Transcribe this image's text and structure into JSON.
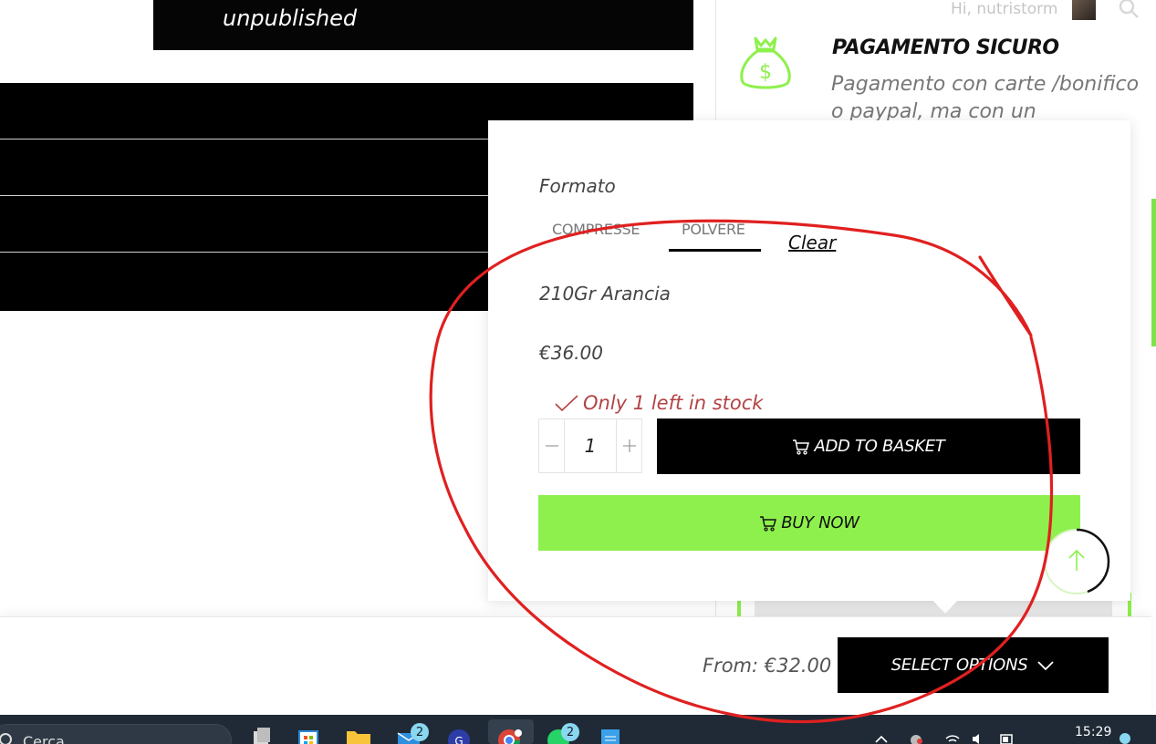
{
  "header": {
    "greeting": "Hi, nutristorm"
  },
  "left": {
    "unpublished_label": "unpublished"
  },
  "sidebar": {
    "title": "PAGAMENTO SICURO",
    "description": "Pagamento con carte /bonifico o paypal, ma con un"
  },
  "popup": {
    "attribute_label": "Formato",
    "options": [
      "COMPRESSE",
      "POLVERE"
    ],
    "selected_option": "POLVERE",
    "clear_label": "Clear",
    "variant_name": "210Gr Arancia",
    "price": "€36.00",
    "stock_text": "Only 1 left in stock",
    "quantity": "1",
    "add_to_basket_label": "ADD TO BASKET",
    "buy_now_label": "BUY NOW"
  },
  "sticky_bar": {
    "from_price": "From: €32.00",
    "select_options_label": "SELECT OPTIONS"
  },
  "taskbar": {
    "search_label": "Cerca",
    "mail_badge": "2",
    "whatsapp_badge": "2",
    "clock": "15:29"
  },
  "colors": {
    "accent_green": "#8ef04d",
    "stock_red": "#b24343",
    "annotation_red": "#e02020",
    "button_black": "#000000"
  }
}
